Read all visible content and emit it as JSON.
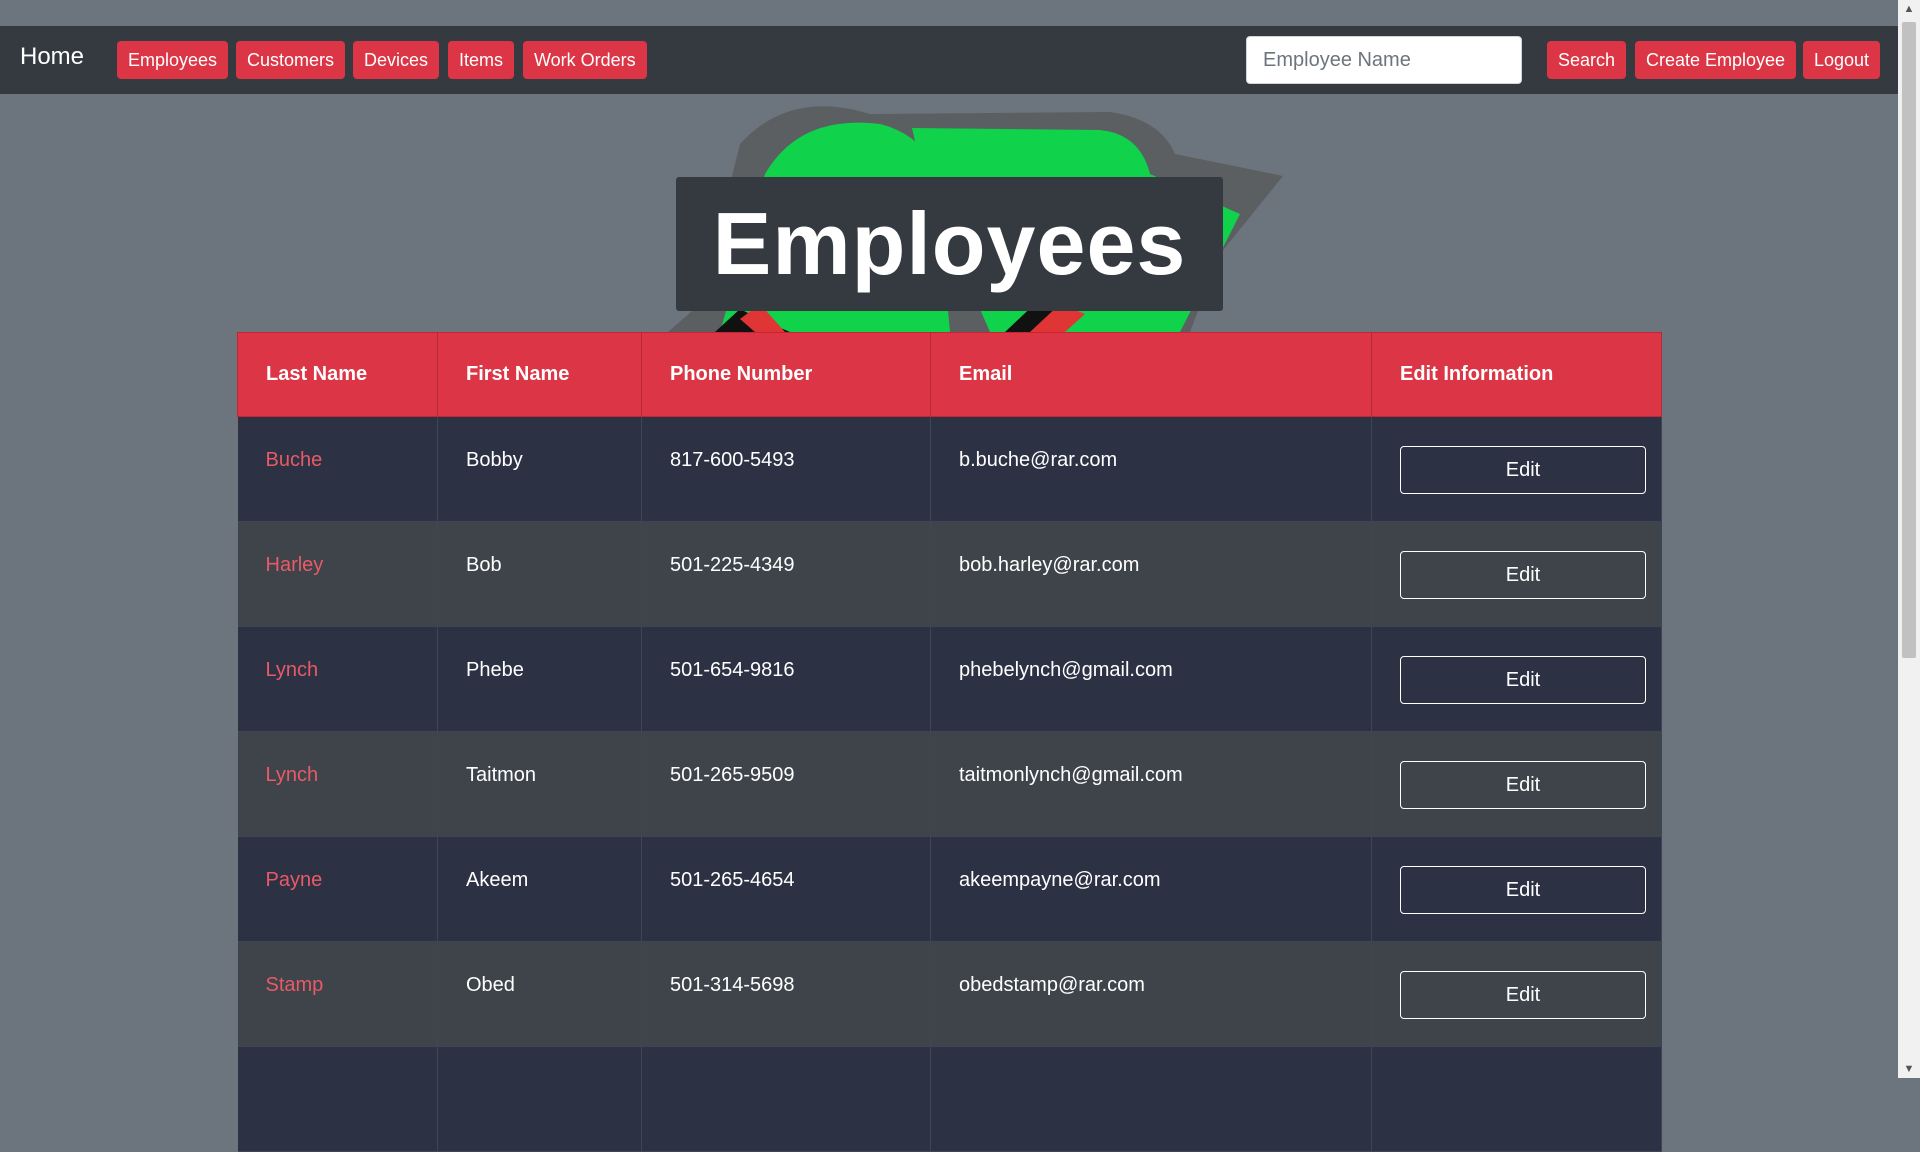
{
  "navbar": {
    "brand": "Home",
    "links": [
      "Employees",
      "Customers",
      "Devices",
      "Items",
      "Work Orders"
    ],
    "search_placeholder": "Employee Name",
    "search_value": "",
    "search_label": "Search",
    "create_label": "Create Employee",
    "logout_label": "Logout"
  },
  "page": {
    "title": "Employees"
  },
  "colors": {
    "accent": "#dc3545",
    "navbar": "#343a40",
    "background": "#6c757d",
    "logo_green": "#10d24b"
  },
  "table": {
    "headers": [
      "Last Name",
      "First Name",
      "Phone Number",
      "Email",
      "Edit Information"
    ],
    "edit_label": "Edit",
    "rows": [
      {
        "last": "Buche",
        "first": "Bobby",
        "phone": "817-600-5493",
        "email": "b.buche@rar.com"
      },
      {
        "last": "Harley",
        "first": "Bob",
        "phone": "501-225-4349",
        "email": "bob.harley@rar.com"
      },
      {
        "last": "Lynch",
        "first": "Phebe",
        "phone": "501-654-9816",
        "email": "phebelynch@gmail.com"
      },
      {
        "last": "Lynch",
        "first": "Taitmon",
        "phone": "501-265-9509",
        "email": "taitmonlynch@gmail.com"
      },
      {
        "last": "Payne",
        "first": "Akeem",
        "phone": "501-265-4654",
        "email": "akeempayne@rar.com"
      },
      {
        "last": "Stamp",
        "first": "Obed",
        "phone": "501-314-5698",
        "email": "obedstamp@rar.com"
      }
    ]
  }
}
